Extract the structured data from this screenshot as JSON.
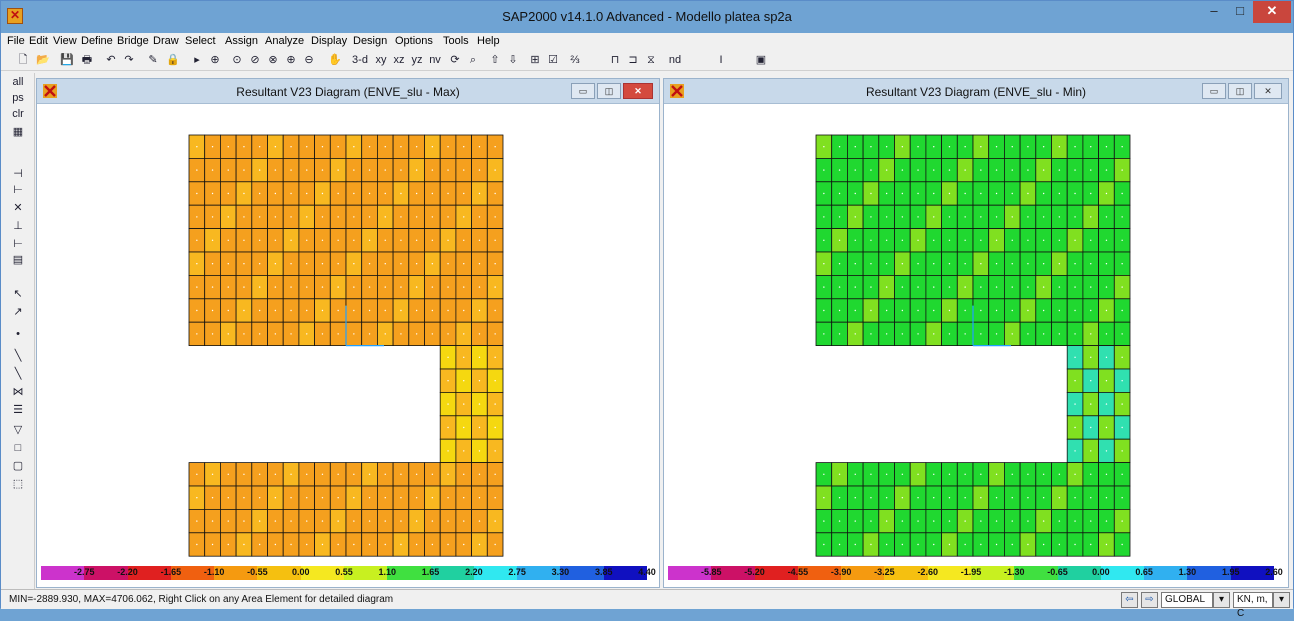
{
  "app": {
    "title": "SAP2000 v14.1.0 Advanced  - Modello platea sp2a",
    "min_label": "–",
    "max_label": "□",
    "close_label": "✕"
  },
  "menu": [
    "File",
    "Edit",
    "View",
    "Define",
    "Bridge",
    "Draw",
    "Select",
    "Assign",
    "Analyze",
    "Display",
    "Design",
    "Options",
    "Tools",
    "Help"
  ],
  "toolbar": {
    "view_3d": "3-d",
    "view_xy": "xy",
    "view_xz": "xz",
    "view_yz": "yz",
    "view_nv": "nv",
    "nd": "nd",
    "fraction": "⅔"
  },
  "left_toolbar": [
    "all",
    "ps",
    "clr"
  ],
  "windows": {
    "left": {
      "title": "Resultant V23 Diagram   (ENVE_slu - Max)",
      "legend_labels": [
        "-2.75",
        "-2.20",
        "-1.65",
        "-1.10",
        "-0.55",
        "0.00",
        "0.55",
        "1.10",
        "1.65",
        "2.20",
        "2.75",
        "3.30",
        "3.85",
        "4.40"
      ]
    },
    "right": {
      "title": "Resultant V23 Diagram   (ENVE_slu - Min)",
      "legend_labels": [
        "-5.85",
        "-5.20",
        "-4.55",
        "-3.90",
        "-3.25",
        "-2.60",
        "-1.95",
        "-1.30",
        "-0.65",
        "0.00",
        "0.65",
        "1.30",
        "1.95",
        "2.60"
      ]
    }
  },
  "legend_colors": [
    "#cc33cc",
    "#cc1166",
    "#e02020",
    "#f06010",
    "#f59a10",
    "#f5c010",
    "#f5e820",
    "#c8f020",
    "#40e040",
    "#20d0a0",
    "#30e8f0",
    "#30b0f0",
    "#2060e0",
    "#1010c0"
  ],
  "plot_colors": {
    "max_base": "#f5a01e",
    "max_light": "#f8b820",
    "max_yellow": "#f5d810",
    "min_base": "#20d830",
    "min_light": "#80e020",
    "min_cyan": "#30e0b0"
  },
  "status": {
    "text": "MIN=-2889.930, MAX=4706.062, Right Click on any Area Element for detailed diagram",
    "coord": "GLOBAL",
    "units": "KN, m, C"
  }
}
